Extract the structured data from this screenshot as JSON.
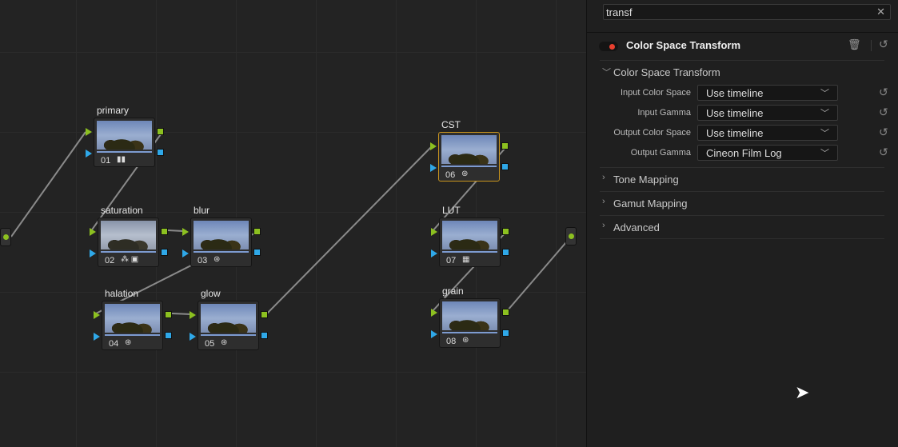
{
  "nodes": [
    {
      "label": "primary",
      "num": "01",
      "icon": "bars-icon",
      "glyph": "▮▮"
    },
    {
      "label": "saturation",
      "num": "02",
      "icon": "rgb-mixer-icon",
      "glyph": "⁂ ▣"
    },
    {
      "label": "blur",
      "num": "03",
      "icon": "fx-icon",
      "glyph": "⊛"
    },
    {
      "label": "halation",
      "num": "04",
      "icon": "fx-icon",
      "glyph": "⊛"
    },
    {
      "label": "glow",
      "num": "05",
      "icon": "fx-icon",
      "glyph": "⊛"
    },
    {
      "label": "CST",
      "num": "06",
      "icon": "fx-icon",
      "glyph": "⊛"
    },
    {
      "label": "LUT",
      "num": "07",
      "icon": "lut-grid-icon",
      "glyph": "▦"
    },
    {
      "label": "grain",
      "num": "08",
      "icon": "fx-icon",
      "glyph": "⊛"
    }
  ],
  "panel": {
    "search": "transf",
    "title": "Color Space Transform",
    "section": "Color Space Transform",
    "params": [
      {
        "label": "Input Color Space",
        "value": "Use timeline"
      },
      {
        "label": "Input Gamma",
        "value": "Use timeline"
      },
      {
        "label": "Output Color Space",
        "value": "Use timeline"
      },
      {
        "label": "Output Gamma",
        "value": "Cineon Film Log"
      }
    ],
    "collapsed": [
      "Tone Mapping",
      "Gamut Mapping",
      "Advanced"
    ]
  },
  "colors": {
    "selected": "#c8941e",
    "rgb_pin": "#8cc020",
    "alpha_pin": "#2fa8e8",
    "enabled": "#e8402f"
  }
}
